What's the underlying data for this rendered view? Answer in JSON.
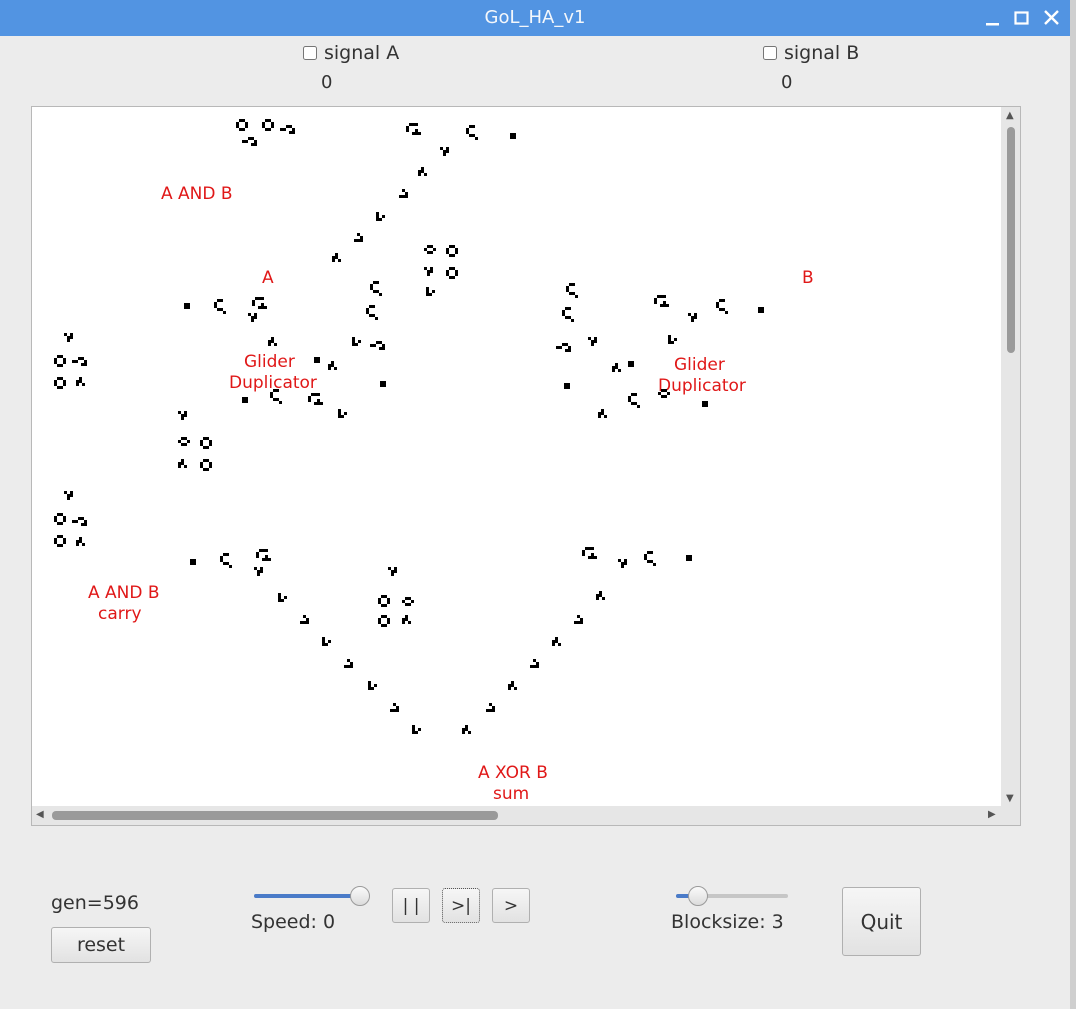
{
  "window": {
    "title": "GoL_HA_v1",
    "icons": [
      "minimize-icon",
      "maximize-icon",
      "close-icon"
    ]
  },
  "signals": {
    "a": {
      "label": "signal A",
      "checked": false,
      "value": "0"
    },
    "b": {
      "label": "signal B",
      "checked": false,
      "value": "0"
    }
  },
  "board": {
    "labels": {
      "and_top": "A AND B",
      "a": "A",
      "b": "B",
      "dup_left_1": "Glider",
      "dup_left_2": "Duplicator",
      "dup_right_1": "Glider",
      "dup_right_2": "Duplicator",
      "carry_1": "A AND B",
      "carry_2": "carry",
      "sum_1": "A XOR B",
      "sum_2": "sum"
    },
    "label_color": "#e01818",
    "cell_color": "#000000"
  },
  "controls": {
    "generation": "gen=596",
    "reset_label": "reset",
    "speed_label": "Speed: 0",
    "speed_level": 1.0,
    "pause_label": "| |",
    "step_label": ">|",
    "run_label": ">",
    "blocksize_label": "Blocksize: 3",
    "blocksize_level": 0.2,
    "quit_label": "Quit"
  }
}
